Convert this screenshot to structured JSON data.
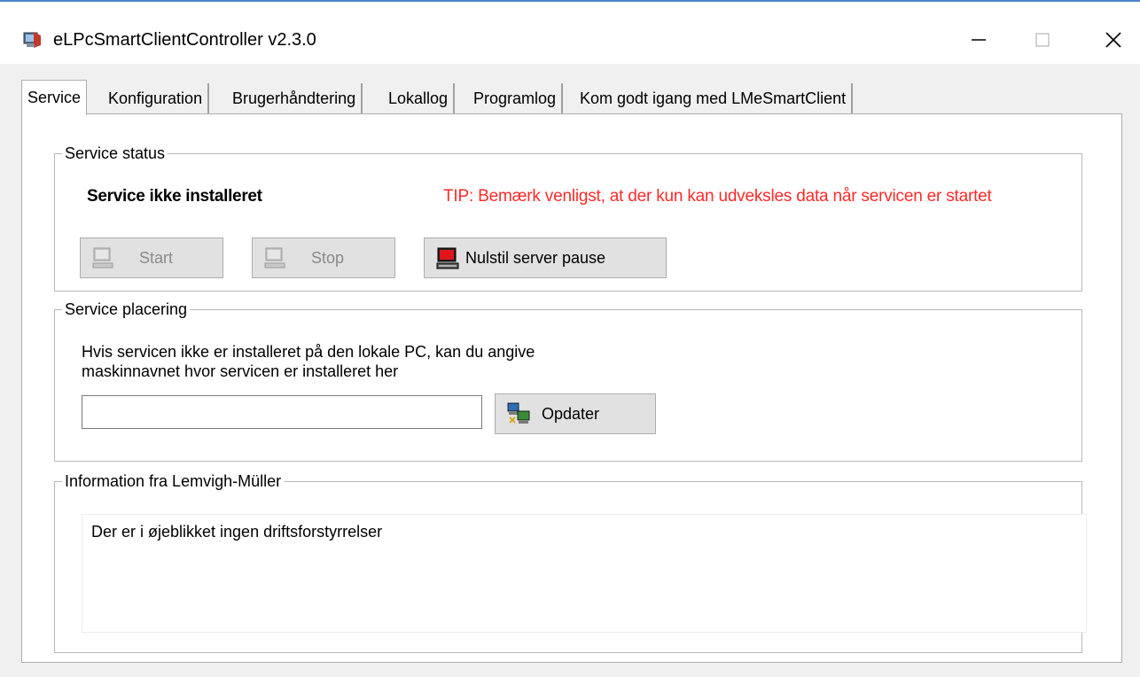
{
  "window": {
    "title": "eLPcSmartClientController v2.3.0",
    "icons": {
      "app": "app-icon",
      "minimize": "minimize-icon",
      "maximize": "maximize-icon",
      "close": "close-icon"
    }
  },
  "tabs": [
    {
      "label": "Service",
      "active": true
    },
    {
      "label": "Konfiguration",
      "active": false
    },
    {
      "label": "Brugerhåndtering",
      "active": false
    },
    {
      "label": "Lokallog",
      "active": false
    },
    {
      "label": "Programlog",
      "active": false
    },
    {
      "label": "Kom godt igang med LMeSmartClient",
      "active": false
    }
  ],
  "service_status": {
    "legend": "Service status",
    "status": "Service ikke installeret",
    "tip": "TIP: Bemærk venligst, at der kun kan udveksles data når servicen er startet",
    "tip_color": "#ff2a2a",
    "buttons": {
      "start": {
        "label": "Start",
        "enabled": false,
        "icon": "computer-icon"
      },
      "stop": {
        "label": "Stop",
        "enabled": false,
        "icon": "computer-icon"
      },
      "reset": {
        "label": "Nulstil server pause",
        "enabled": true,
        "icon": "computer-red-icon"
      }
    }
  },
  "service_placement": {
    "legend": "Service placering",
    "hint_line1": "Hvis servicen ikke er installeret på den lokale PC, kan du angive",
    "hint_line2": "maskinnavnet hvor servicen er installeret her",
    "machine_value": "",
    "update_button": {
      "label": "Opdater",
      "icon": "network-computers-icon"
    }
  },
  "information": {
    "legend": "Information fra Lemvigh-Müller",
    "message": "Der er i øjeblikket ingen driftsforstyrrelser"
  }
}
